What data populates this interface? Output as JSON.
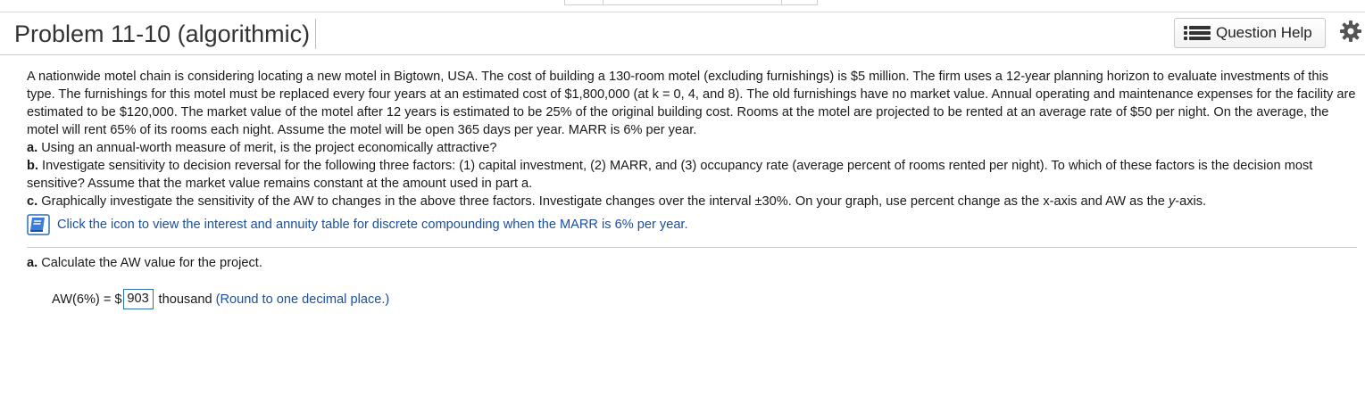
{
  "header": {
    "title": "Problem 11-10 (algorithmic)",
    "help_button_label": "Question Help",
    "settings_icon": "gear-icon",
    "help_icon": "list-icon"
  },
  "problem": {
    "intro": "A nationwide motel chain is considering locating a new motel in Bigtown, USA. The cost of building a 130-room motel (excluding furnishings) is $5 million. The firm uses a 12-year planning horizon to evaluate investments of this type. The furnishings for this motel must be replaced every four years at an estimated cost of $1,800,000 (at k = 0, 4, and 8). The old furnishings have no market value. Annual operating and maintenance expenses for the facility are estimated to be $120,000. The market value of the motel after 12 years is estimated to be 25% of the original building cost. Rooms at the motel are projected to be rented at an average rate of $50 per night. On the average, the motel will rent 65% of its rooms each night. Assume the motel will be open 365 days per year. MARR is 6% per year.",
    "part_a_label": "a.",
    "part_a_text": "Using an annual-worth measure of merit, is the project economically attractive?",
    "part_b_label": "b.",
    "part_b_text": "Investigate sensitivity to decision reversal for the following three factors: (1) capital investment, (2) MARR, and (3) occupancy rate (average percent of rooms rented per night). To which of these factors is the decision most sensitive? Assume that the market value remains constant at the amount used in part a.",
    "part_c_label": "c.",
    "part_c_text": "Graphically investigate the sensitivity of the AW to changes in the above three factors. Investigate changes over the interval ±30%. On your graph, use percent change as the x-axis and AW as the ",
    "part_c_ital": "y",
    "part_c_tail": "-axis.",
    "table_link": "Click the icon to view the interest and annuity table for discrete compounding when the MARR is 6% per year."
  },
  "answer": {
    "section_label": "a.",
    "section_text": "Calculate the AW value for the project.",
    "prefix": "AW(6%) = $",
    "value": "903",
    "unit": "thousand",
    "hint": "(Round to one decimal place.)"
  }
}
